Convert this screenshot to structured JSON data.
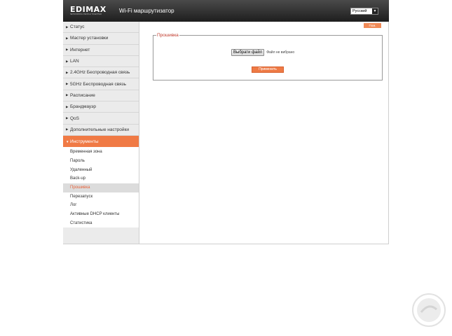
{
  "header": {
    "logo_text": "EDIMAX",
    "logo_tagline": "NETWORKING PEOPLE TOGETHER",
    "product_title": "Wi-Fi маршрутизатор",
    "language": "Русский"
  },
  "help_label": "Пом.",
  "sidebar": {
    "items": [
      {
        "label": "Статус"
      },
      {
        "label": "Мастер установки"
      },
      {
        "label": "Интернет"
      },
      {
        "label": "LAN"
      },
      {
        "label": "2.4GHz Беспроводная связь"
      },
      {
        "label": "5GHz Беспроводная связь"
      },
      {
        "label": "Расписание"
      },
      {
        "label": "Брандмауэр"
      },
      {
        "label": "QoS"
      },
      {
        "label": "Дополнительные настройки"
      },
      {
        "label": "Инструменты"
      }
    ],
    "sub_items": [
      {
        "label": "Временная зона"
      },
      {
        "label": "Пароль"
      },
      {
        "label": "Удаленный"
      },
      {
        "label": "Back-up"
      },
      {
        "label": "Прошивка"
      },
      {
        "label": "Перезапуск"
      },
      {
        "label": "Лог"
      },
      {
        "label": "Активные DHCP клиенты"
      },
      {
        "label": "Статистика"
      }
    ]
  },
  "firmware": {
    "title": "Прошивка",
    "choose_file_label": "Выбрати файл",
    "no_file_text": "Файл не вибрано",
    "apply_label": "Применить"
  },
  "colors": {
    "accent": "#f07a45",
    "header_bg": "#2a2a2a",
    "sidebar_bg": "#ebebeb",
    "panel_title": "#c0392b"
  }
}
